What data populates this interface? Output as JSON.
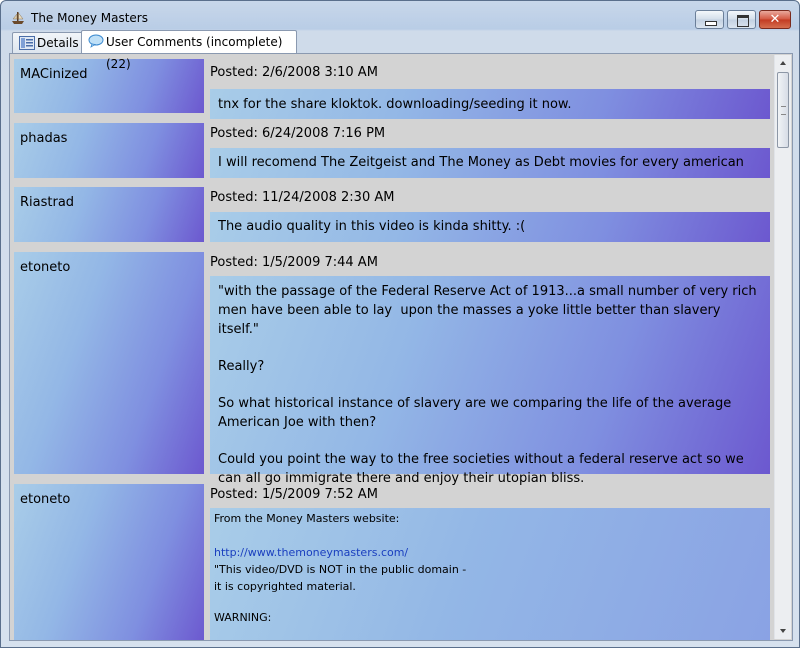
{
  "window": {
    "title": "The Money Masters",
    "icon": "ship-icon",
    "controls": {
      "minimize": "minimize-icon",
      "maximize": "maximize-icon",
      "close_label": "✕"
    }
  },
  "tabs": [
    {
      "label": "Details",
      "icon": "details-icon",
      "active": false
    },
    {
      "label": "User Comments (incomplete) (22)",
      "icon": "speech-bubble-icon",
      "active": true
    }
  ],
  "comments": [
    {
      "author": "MACinized",
      "posted": "Posted: 2/6/2008 3:10 AM",
      "text": "tnx for the share kloktok. downloading/seeding it now."
    },
    {
      "author": "phadas",
      "posted": "Posted: 6/24/2008 7:16 PM",
      "text": "I will recomend The Zeitgeist and The Money as Debt movies for every american"
    },
    {
      "author": "Riastrad",
      "posted": "Posted: 11/24/2008 2:30 AM",
      "text": "The audio quality in this video is kinda shitty. :("
    },
    {
      "author": "etoneto",
      "posted": "Posted: 1/5/2009 7:44 AM",
      "lines": [
        "\"with the passage of the Federal Reserve Act of 1913...a small number of very rich men have been able to lay  upon the masses a yoke little better than slavery itself.\"",
        "Really?",
        "So what historical instance of slavery are we comparing the life of the average American Joe with then?",
        "Could you point the way to the free societies without a federal reserve act so we can all go immigrate there and enjoy their utopian bliss."
      ]
    },
    {
      "author": "etoneto",
      "posted": "Posted: 1/5/2009 7:52 AM",
      "lines": [
        "From the Money Masters website:",
        "",
        "http://www.themoneymasters.com/",
        "\"This video/DVD is NOT in the public domain -",
        "it is copyrighted material.",
        "",
        "WARNING:"
      ]
    }
  ],
  "colors": {
    "comment_gradient_start": "#a9cde8",
    "comment_gradient_end": "#6c58cf",
    "list_background": "#d3d3d3",
    "link": "#1a3fbf"
  }
}
